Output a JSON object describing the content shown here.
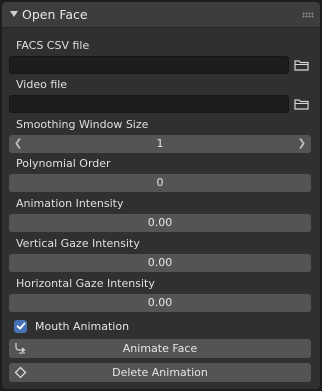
{
  "panel": {
    "title": "Open Face"
  },
  "fields": {
    "facs_label": "FACS CSV file",
    "facs_value": "",
    "video_label": "Video file",
    "video_value": "",
    "smoothing_label": "Smoothing Window Size",
    "smoothing_value": "1",
    "poly_label": "Polynomial Order",
    "poly_value": "0",
    "anim_label": "Animation Intensity",
    "anim_value": "0.00",
    "vgaze_label": "Vertical Gaze Intensity",
    "vgaze_value": "0.00",
    "hgaze_label": "Horizontal Gaze Intensity",
    "hgaze_value": "0.00"
  },
  "mouth": {
    "label": "Mouth Animation",
    "checked": true
  },
  "buttons": {
    "animate": "Animate Face",
    "delete": "Delete Animation"
  },
  "colors": {
    "accent": "#4772b3",
    "field": "#545454",
    "panel": "#303030"
  },
  "icons": {
    "collapse": "triangle-down-icon",
    "grip": "drag-grip-icon",
    "folder": "folder-icon",
    "check": "checkmark-icon",
    "animate": "curve-arrow-icon",
    "delete": "diamond-icon"
  }
}
